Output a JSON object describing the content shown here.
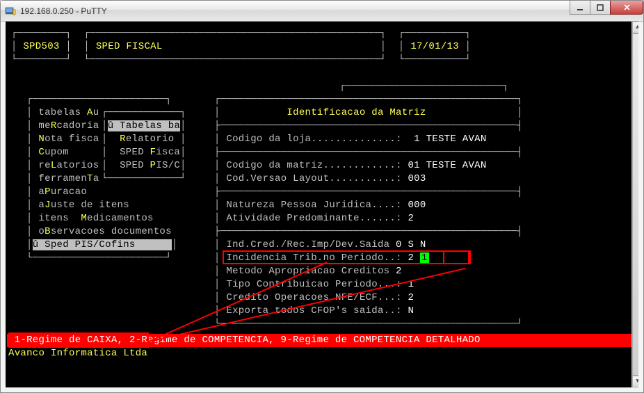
{
  "window": {
    "title": "192.168.0.250 - PuTTY"
  },
  "header": {
    "code": "SPD503",
    "title": "SPED FISCAL",
    "date": "17/01/13"
  },
  "menu": {
    "items": [
      {
        "pre": "tabelas ",
        "hot": "A",
        "post": "u"
      },
      {
        "pre": "me",
        "hot": "R",
        "post": "cadoria"
      },
      {
        "pre": "",
        "hot": "N",
        "post": "ota fisca"
      },
      {
        "pre": "",
        "hot": "C",
        "post": "upom"
      },
      {
        "pre": "re",
        "hot": "L",
        "post": "atorios"
      },
      {
        "pre": "ferramen",
        "hot": "T",
        "post": "a"
      },
      {
        "pre": "a",
        "hot": "P",
        "post": "uracao"
      },
      {
        "pre": "a",
        "hot": "J",
        "post": "uste de itens"
      },
      {
        "pre": "itens  ",
        "hot": "M",
        "post": "edicamentos"
      },
      {
        "pre": "o",
        "hot": "B",
        "post": "servacoes documentos"
      }
    ],
    "selected": {
      "pre": "û ",
      "hot": "S",
      "post": "ped PIS/Cofins"
    }
  },
  "submenu": {
    "items": [
      {
        "pre": "û ",
        "hot": "T",
        "post": "abelas ba"
      },
      {
        "pre": "  ",
        "hot": "R",
        "post": "elatorio"
      },
      {
        "pre": "  SPED ",
        "hot": "F",
        "post": "isca"
      },
      {
        "pre": "  SPED ",
        "hot": "P",
        "post": "IS/C"
      }
    ]
  },
  "panel": {
    "title": "Identificacao da Matriz",
    "rows": [
      {
        "label": "Codigo da loja",
        "dots": "..............",
        "value": "1 TESTE AVAN"
      },
      {
        "label": "Codigo da matriz",
        "dots": "............",
        "value": "01 TESTE AVAN"
      },
      {
        "label": "Cod.Versao Layout",
        "dots": "...........",
        "value": "003"
      },
      {
        "label": "Natureza Pessoa Juridica",
        "dots": "....",
        "value": "000"
      },
      {
        "label": "Atividade Predominante",
        "dots": "......",
        "value": "2"
      },
      {
        "label": "Ind.Cred./Rec.Imp/Dev.Saida",
        "dots": ":",
        "value": "0 S N"
      },
      {
        "label": "Incidencia Trib.no Periodo",
        "dots": "..",
        "value": "2",
        "cursor": "1"
      },
      {
        "label": "Metodo Apropriacao Creditos",
        "dots": ":",
        "value": "2"
      },
      {
        "label": "Tipo Contribuicao Periodo",
        "dots": "...",
        "value": "1"
      },
      {
        "label": "Credito Operacoes NFE/ECF",
        "dots": "...",
        "value": "2"
      },
      {
        "label": "Exporta todos CFOP's saida",
        "dots": "..",
        "value": "N"
      }
    ]
  },
  "footer": {
    "options": " 1-Regime de CAIXA, 2-Regime de COMPETENCIA, 9-Regime de COMPETENCIA DETALHADO ",
    "company": "Avanco Informatica Ltda"
  }
}
